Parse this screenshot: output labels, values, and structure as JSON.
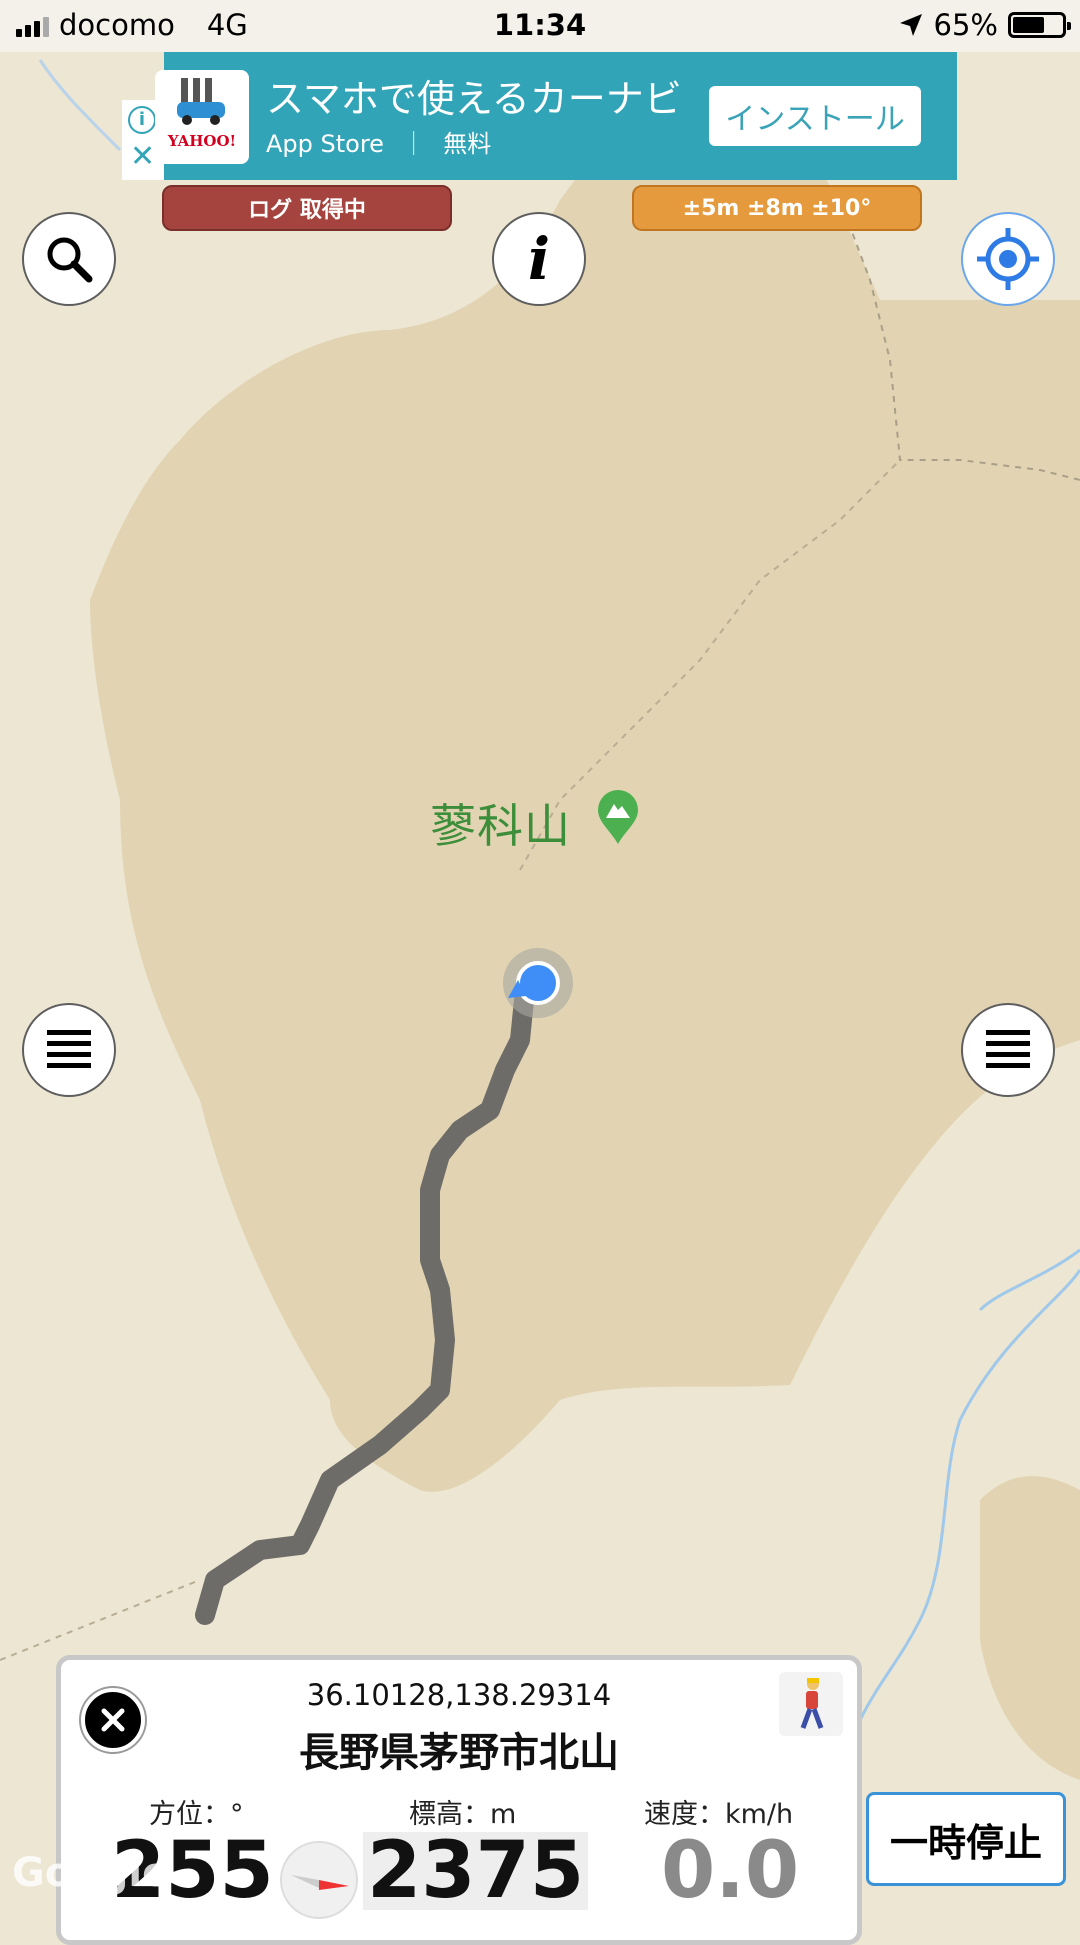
{
  "status_bar": {
    "carrier": "docomo",
    "network": "4G",
    "time": "11:34",
    "battery": "65%",
    "battery_level": 0.65
  },
  "ad": {
    "headline": "スマホで使えるカーナビ",
    "store": "App Store",
    "separator": "｜",
    "price": "無料",
    "install": "インストール",
    "brand": "YAHOO!"
  },
  "pills": {
    "log_status": "ログ 取得中",
    "accuracy": "±5m ±8m ±10°"
  },
  "map": {
    "peak_name": "蓼科山"
  },
  "info_card": {
    "coordinates": "36.10128,138.29314",
    "place": "長野県茅野市北山",
    "stats": [
      {
        "label": "方位：°",
        "value": "255"
      },
      {
        "label": "標高：m",
        "value": "2375"
      },
      {
        "label": "速度：km/h",
        "value": "0.0"
      }
    ]
  },
  "pause_button": "一時停止",
  "watermark": "Google",
  "colors": {
    "log_pill": "#a5443f",
    "accuracy_pill": "#e69a3e",
    "ad_bg": "#32a4b7",
    "location_blue": "#3f8ef7",
    "track": "#6e6c68"
  }
}
